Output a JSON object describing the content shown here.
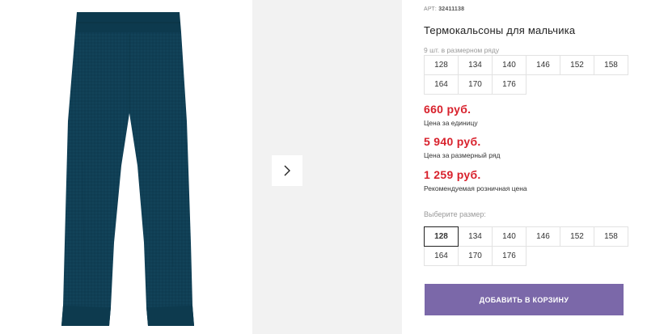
{
  "product": {
    "article_label": "АРТ:",
    "article_number": "32411138",
    "title": "Термокальсоны для мальчика",
    "color_hex": "#103f55"
  },
  "pack": {
    "note": "9 шт. в размерном ряду",
    "sizes": [
      "128",
      "134",
      "140",
      "146",
      "152",
      "158",
      "164",
      "170",
      "176"
    ]
  },
  "prices": {
    "unit_price": "660 руб.",
    "unit_label": "Цена за единицу",
    "pack_price": "5 940 руб.",
    "pack_label": "Цена за размерный ряд",
    "retail_price": "1 259 руб.",
    "retail_label": "Рекомендуемая розничная цена"
  },
  "size_picker": {
    "label": "Выберите размер:",
    "sizes": [
      "128",
      "134",
      "140",
      "146",
      "152",
      "158",
      "164",
      "170",
      "176"
    ],
    "selected": "128"
  },
  "cart": {
    "button_label": "ДОБАВИТЬ В КОРЗИНУ",
    "button_color": "#7b68a9"
  },
  "gallery": {
    "next_icon": "chevron-right-icon"
  }
}
